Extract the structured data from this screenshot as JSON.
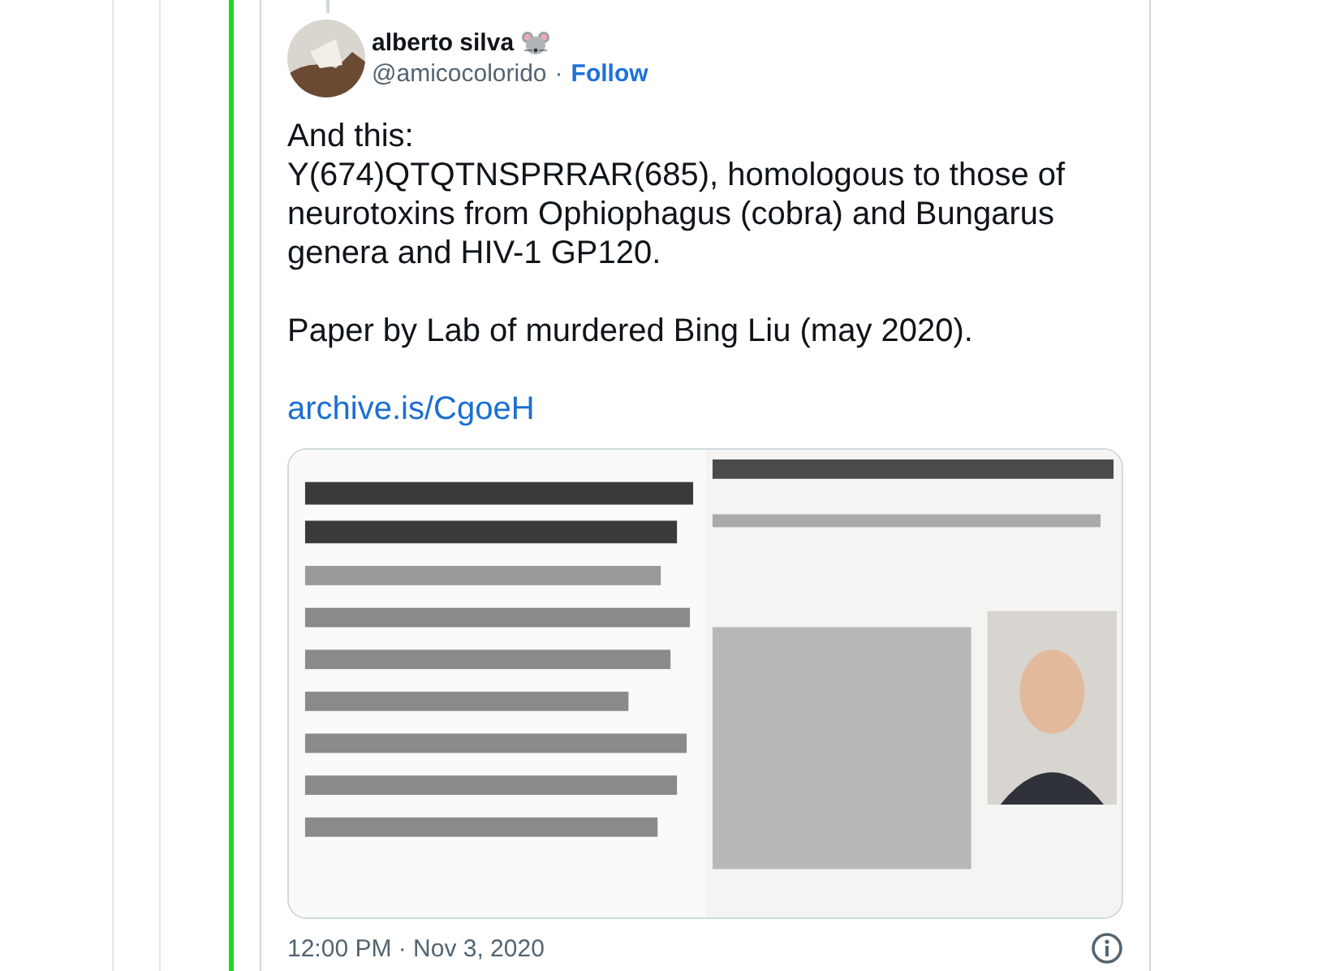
{
  "tweet": {
    "author": {
      "name": "alberto silva",
      "handle": "@amicocolorido",
      "separator": "·",
      "follow": "Follow"
    },
    "paragraphs": [
      "And this:\nY(674)QTQTNSPRRAR(685), homologous to those of neurotoxins from Ophiophagus (cobra) and Bungarus genera and HIV-1 GP120.",
      "Paper by Lab of murdered Bing Liu (may 2020)."
    ],
    "link": "archive.is/CgoeH",
    "timestamp": "12:00 PM · Nov 3, 2020"
  }
}
